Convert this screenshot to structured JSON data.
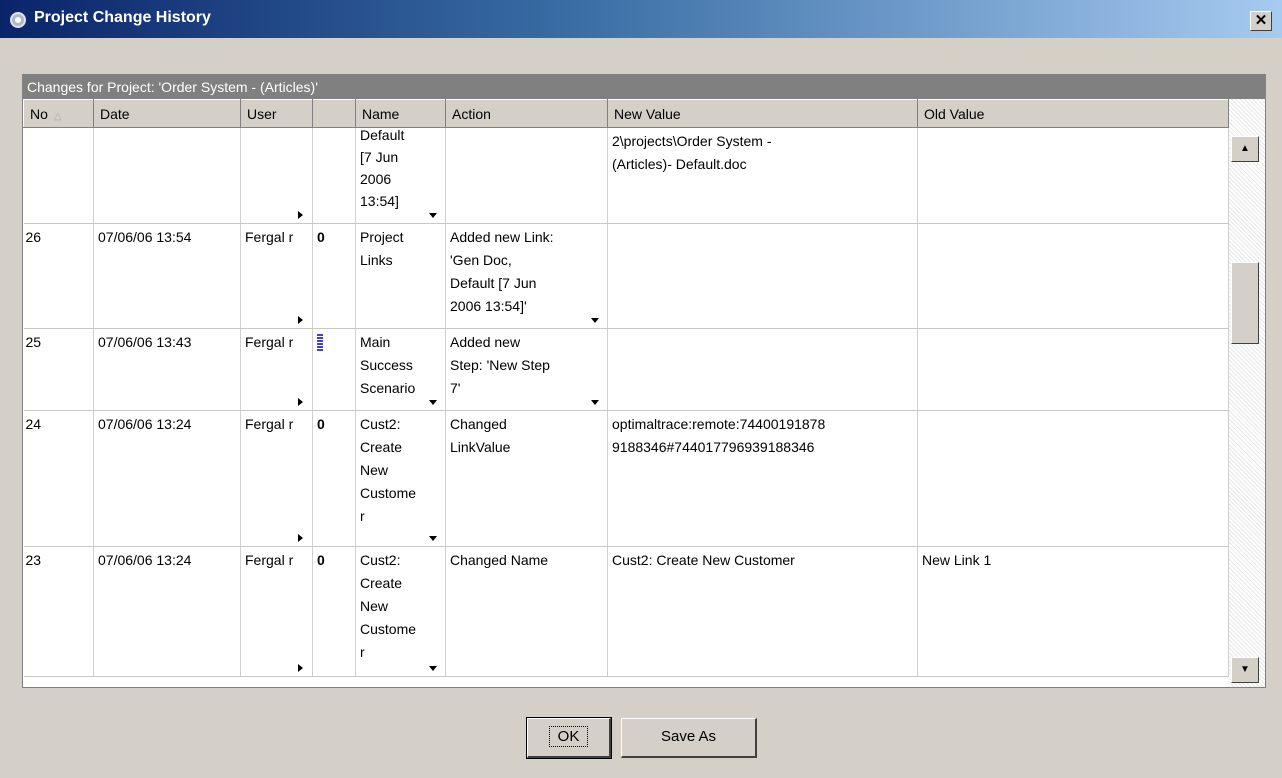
{
  "window": {
    "title": "Project Change History",
    "close_label": "✕"
  },
  "panel": {
    "header": "Changes for Project: 'Order System - (Articles)'"
  },
  "table": {
    "columns": [
      "No",
      "Date",
      "User",
      "",
      "Name",
      "Action",
      "New Value",
      "Old Value"
    ],
    "sort_indicator": "△",
    "rows": [
      {
        "no": "",
        "date": "",
        "user": "",
        "icon": "",
        "name": "Default\n[7 Jun\n2006\n13:54]",
        "action": "",
        "new_value": "2\\projects\\Order System -\n(Articles)- Default.doc",
        "old_value": ""
      },
      {
        "no": "26",
        "date": "07/06/06 13:54",
        "user": "Fergal r",
        "icon": "paperclip-icon",
        "name": "Project\nLinks",
        "action": "Added new Link:\n'Gen Doc,\nDefault [7 Jun\n2006 13:54]'",
        "new_value": "",
        "old_value": ""
      },
      {
        "no": "25",
        "date": "07/06/06 13:43",
        "user": "Fergal r",
        "icon": "step-icon",
        "name": "Main\nSuccess\nScenario",
        "action": "Added new\nStep: 'New Step\n7'",
        "new_value": "",
        "old_value": ""
      },
      {
        "no": "24",
        "date": "07/06/06 13:24",
        "user": "Fergal r",
        "icon": "paperclip-icon",
        "name": "Cust2:\nCreate\nNew\nCustome\nr",
        "action": "Changed\nLinkValue",
        "new_value": "optimaltrace:remote:74400191878\n9188346#744017796939188346",
        "old_value": ""
      },
      {
        "no": "23",
        "date": "07/06/06 13:24",
        "user": "Fergal r",
        "icon": "paperclip-icon",
        "name": "Cust2:\nCreate\nNew\nCustome\nr",
        "action": "Changed Name",
        "new_value": "Cust2: Create New Customer",
        "old_value": "New Link 1"
      }
    ]
  },
  "scrollbar": {
    "up_arrow": "▲",
    "down_arrow": "▼"
  },
  "buttons": {
    "ok": "OK",
    "save_as": "Save As"
  }
}
